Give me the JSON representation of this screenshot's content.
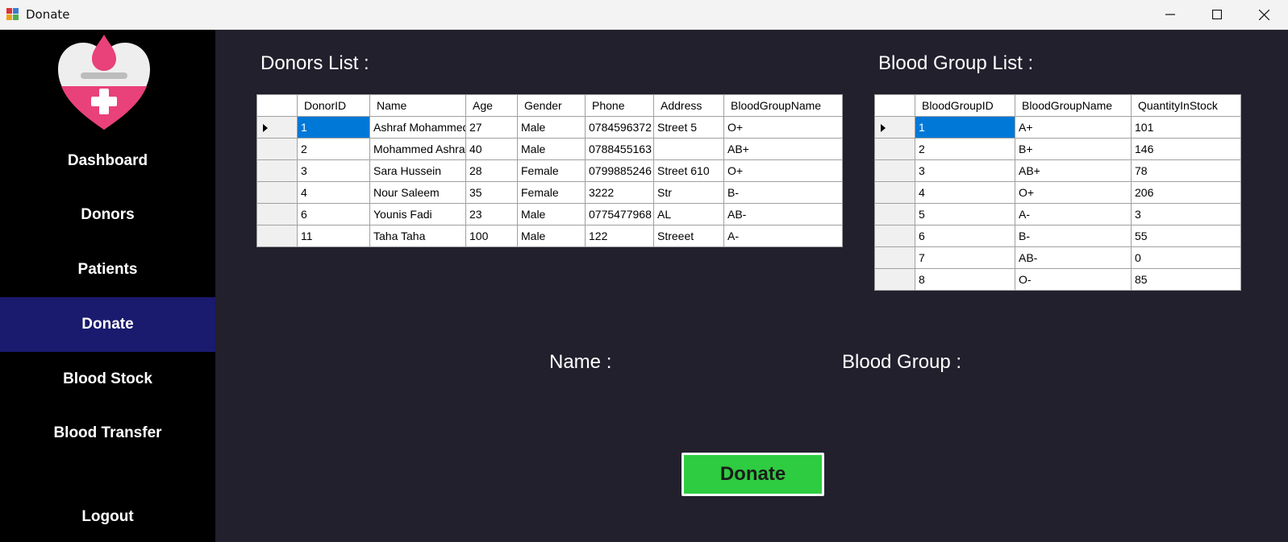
{
  "window": {
    "title": "Donate",
    "icon": "app-window-icon",
    "controls": [
      "minimize-icon",
      "maximize-icon",
      "close-icon"
    ]
  },
  "sidebar": {
    "logo": "blood-drop-heart-logo",
    "items": [
      {
        "label": "Dashboard",
        "active": false
      },
      {
        "label": "Donors",
        "active": false
      },
      {
        "label": "Patients",
        "active": false
      },
      {
        "label": "Donate",
        "active": true
      },
      {
        "label": "Blood Stock",
        "active": false
      },
      {
        "label": "Blood Transfer",
        "active": false
      },
      {
        "label": "Logout",
        "active": false
      }
    ]
  },
  "donors": {
    "title": "Donors List :",
    "columns": [
      "DonorID",
      "Name",
      "Age",
      "Gender",
      "Phone",
      "Address",
      "BloodGroupName"
    ],
    "rows": [
      [
        "1",
        "Ashraf Mohammed",
        "27",
        "Male",
        "0784596372",
        "Street 5",
        "O+"
      ],
      [
        "2",
        "Mohammed Ashraf",
        "40",
        "Male",
        "0788455163",
        "",
        "AB+"
      ],
      [
        "3",
        "Sara Hussein",
        "28",
        "Female",
        "0799885246",
        "Street 610",
        "O+"
      ],
      [
        "4",
        "Nour Saleem",
        "35",
        "Female",
        "3222",
        "Str",
        "B-"
      ],
      [
        "6",
        "Younis Fadi",
        "23",
        "Male",
        "0775477968",
        "AL",
        "AB-"
      ],
      [
        "11",
        "Taha Taha",
        "100",
        "Male",
        "122",
        "Streeet",
        "A-"
      ]
    ]
  },
  "bloodgroups": {
    "title": "Blood Group List :",
    "columns": [
      "BloodGroupID",
      "BloodGroupName",
      "QuantityInStock"
    ],
    "rows": [
      [
        "1",
        "A+",
        "101"
      ],
      [
        "2",
        "B+",
        "146"
      ],
      [
        "3",
        "AB+",
        "78"
      ],
      [
        "4",
        "O+",
        "206"
      ],
      [
        "5",
        "A-",
        "3"
      ],
      [
        "6",
        "B-",
        "55"
      ],
      [
        "7",
        "AB-",
        "0"
      ],
      [
        "8",
        "O-",
        "85"
      ]
    ]
  },
  "form": {
    "name_label": "Name :",
    "blood_group_label": "Blood Group :",
    "donate_button": "Donate"
  },
  "colors": {
    "sidebar_bg": "#000000",
    "sidebar_active": "#1a1a6e",
    "main_bg": "#22202d",
    "donate_button": "#2ecc40",
    "selection": "#0078d7"
  }
}
